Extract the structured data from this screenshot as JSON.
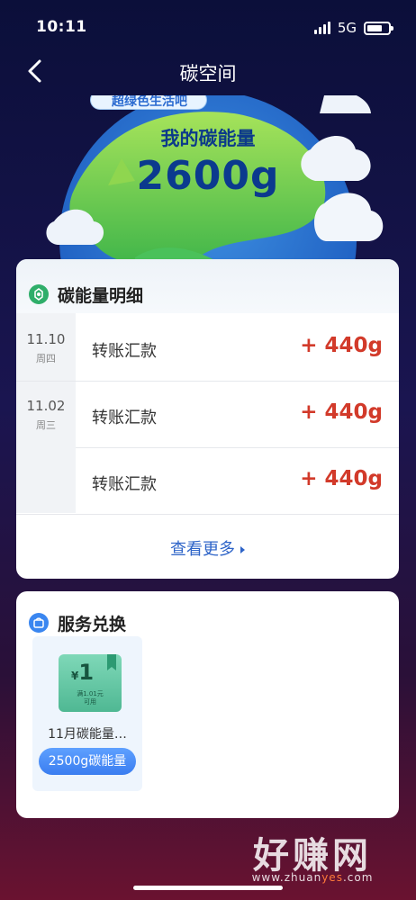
{
  "status_bar": {
    "time": "10:11",
    "network": "5G"
  },
  "nav": {
    "title": "碳空间",
    "back_icon": "chevron-left-icon"
  },
  "hero": {
    "badge_text": "超绿色生活吧",
    "label": "我的碳能量",
    "value": "2600g"
  },
  "detail": {
    "title": "碳能量明细",
    "icon": "recycle-icon",
    "groups": [
      {
        "day": "11.10",
        "weekday": "周四"
      },
      {
        "day": "11.02",
        "weekday": "周三"
      }
    ],
    "rows": [
      {
        "label": "转账汇款",
        "amount": "+ 440g"
      },
      {
        "label": "转账汇款",
        "amount": "+ 440g"
      },
      {
        "label": "转账汇款",
        "amount": "+ 440g"
      }
    ],
    "more": "查看更多"
  },
  "service": {
    "title": "服务兑换",
    "icon": "shopping-bag-icon",
    "items": [
      {
        "coupon_currency": "¥",
        "coupon_value": "1",
        "coupon_condition": "满1.01元",
        "coupon_usable": "可用",
        "name": "11月碳能量…",
        "button": "2500g碳能量"
      }
    ]
  },
  "watermark": {
    "text": "好赚网",
    "url_prefix": "www.zhuan",
    "url_highlight": "yes",
    "url_suffix": ".com"
  },
  "colors": {
    "accent_blue": "#2e64c8",
    "amount_red": "#d23a2a",
    "button_blue": "#3a7df0"
  }
}
